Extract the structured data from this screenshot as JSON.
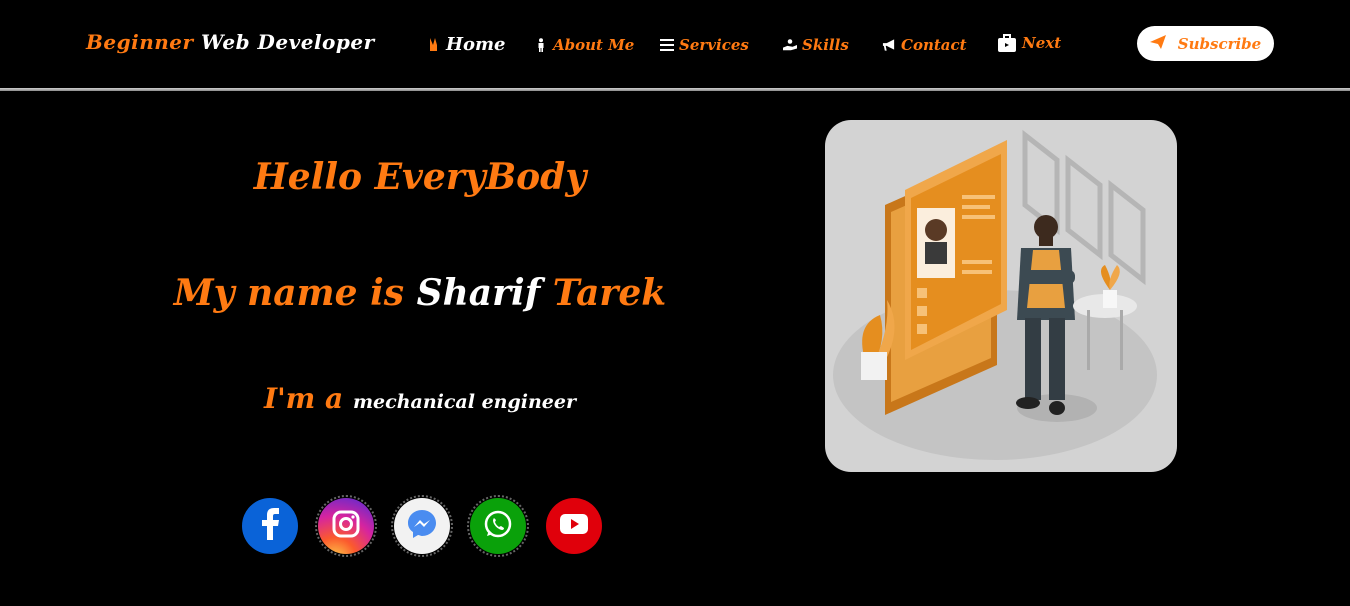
{
  "brand": {
    "part1": "Beginner",
    "part2": "Web Developer"
  },
  "nav": {
    "home": "Home",
    "about": "About Me",
    "services": "Services",
    "skills": "Skills",
    "contact": "Contact",
    "next": "Next",
    "subscribe": "Subscribe"
  },
  "hero": {
    "greeting": "Hello EveryBody",
    "name_prefix": "My name is",
    "first_name": "Sharif",
    "last_name": "Tarek",
    "role_prefix": "I'm a",
    "role": "mechanical engineer"
  },
  "social": [
    "facebook-icon",
    "instagram-icon",
    "messenger-icon",
    "whatsapp-icon",
    "youtube-icon"
  ],
  "colors": {
    "accent": "#ff7a12",
    "background": "#000000",
    "card": "#d3d3d3"
  }
}
